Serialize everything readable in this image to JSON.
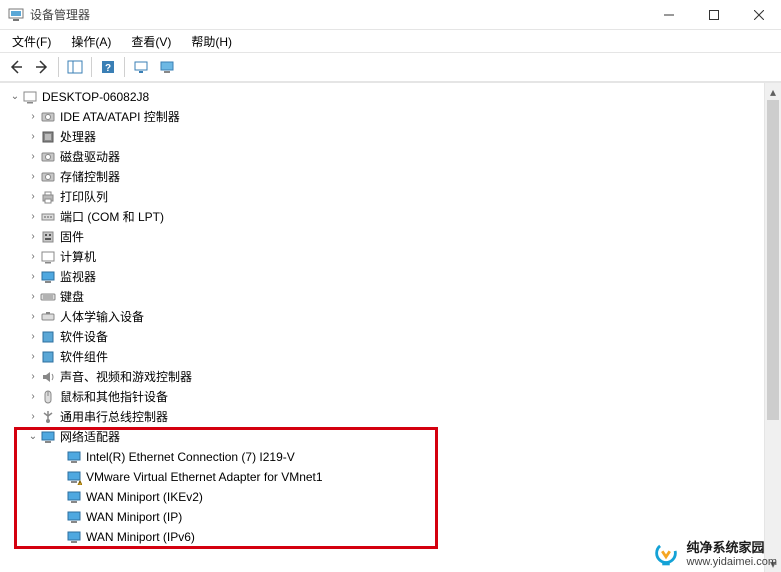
{
  "window": {
    "title": "设备管理器"
  },
  "menu": {
    "file": "文件(F)",
    "action": "操作(A)",
    "view": "查看(V)",
    "help": "帮助(H)"
  },
  "tree": {
    "root": "DESKTOP-06082J8",
    "items": [
      "IDE ATA/ATAPI 控制器",
      "处理器",
      "磁盘驱动器",
      "存储控制器",
      "打印队列",
      "端口 (COM 和 LPT)",
      "固件",
      "计算机",
      "监视器",
      "键盘",
      "人体学输入设备",
      "软件设备",
      "软件组件",
      "声音、视频和游戏控制器",
      "鼠标和其他指针设备",
      "通用串行总线控制器"
    ],
    "expanded": {
      "label": "网络适配器",
      "children": [
        "Intel(R) Ethernet Connection (7) I219-V",
        "VMware Virtual Ethernet Adapter for VMnet1",
        "WAN Miniport (IKEv2)",
        "WAN Miniport (IP)",
        "WAN Miniport (IPv6)"
      ]
    }
  },
  "watermark": {
    "brand": "纯净系统家园",
    "url": "www.yidaimei.com"
  }
}
